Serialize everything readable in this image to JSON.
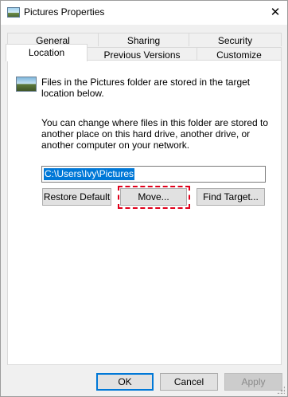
{
  "window": {
    "title": "Pictures Properties",
    "close_glyph": "✕",
    "icon": "pictures-folder-icon"
  },
  "tabs": {
    "row_back": [
      "General",
      "Sharing",
      "Security"
    ],
    "row_front": [
      "Location",
      "Previous Versions",
      "Customize"
    ],
    "active": "Location"
  },
  "location": {
    "intro_text": "Files in the Pictures folder are stored in the target location below.",
    "change_text": "You can change where files in this folder are stored to another place on this hard drive, another drive, or another computer on your network.",
    "path_value": "C:\\Users\\Ivy\\Pictures",
    "restore_default_label": "Restore Default",
    "move_label": "Move...",
    "find_target_label": "Find Target..."
  },
  "footer": {
    "ok_label": "OK",
    "cancel_label": "Cancel",
    "apply_label": "Apply"
  },
  "colors": {
    "selection": "#0078d7",
    "highlight_outline": "#e0001b",
    "dialog_background": "#f0f0f0"
  }
}
